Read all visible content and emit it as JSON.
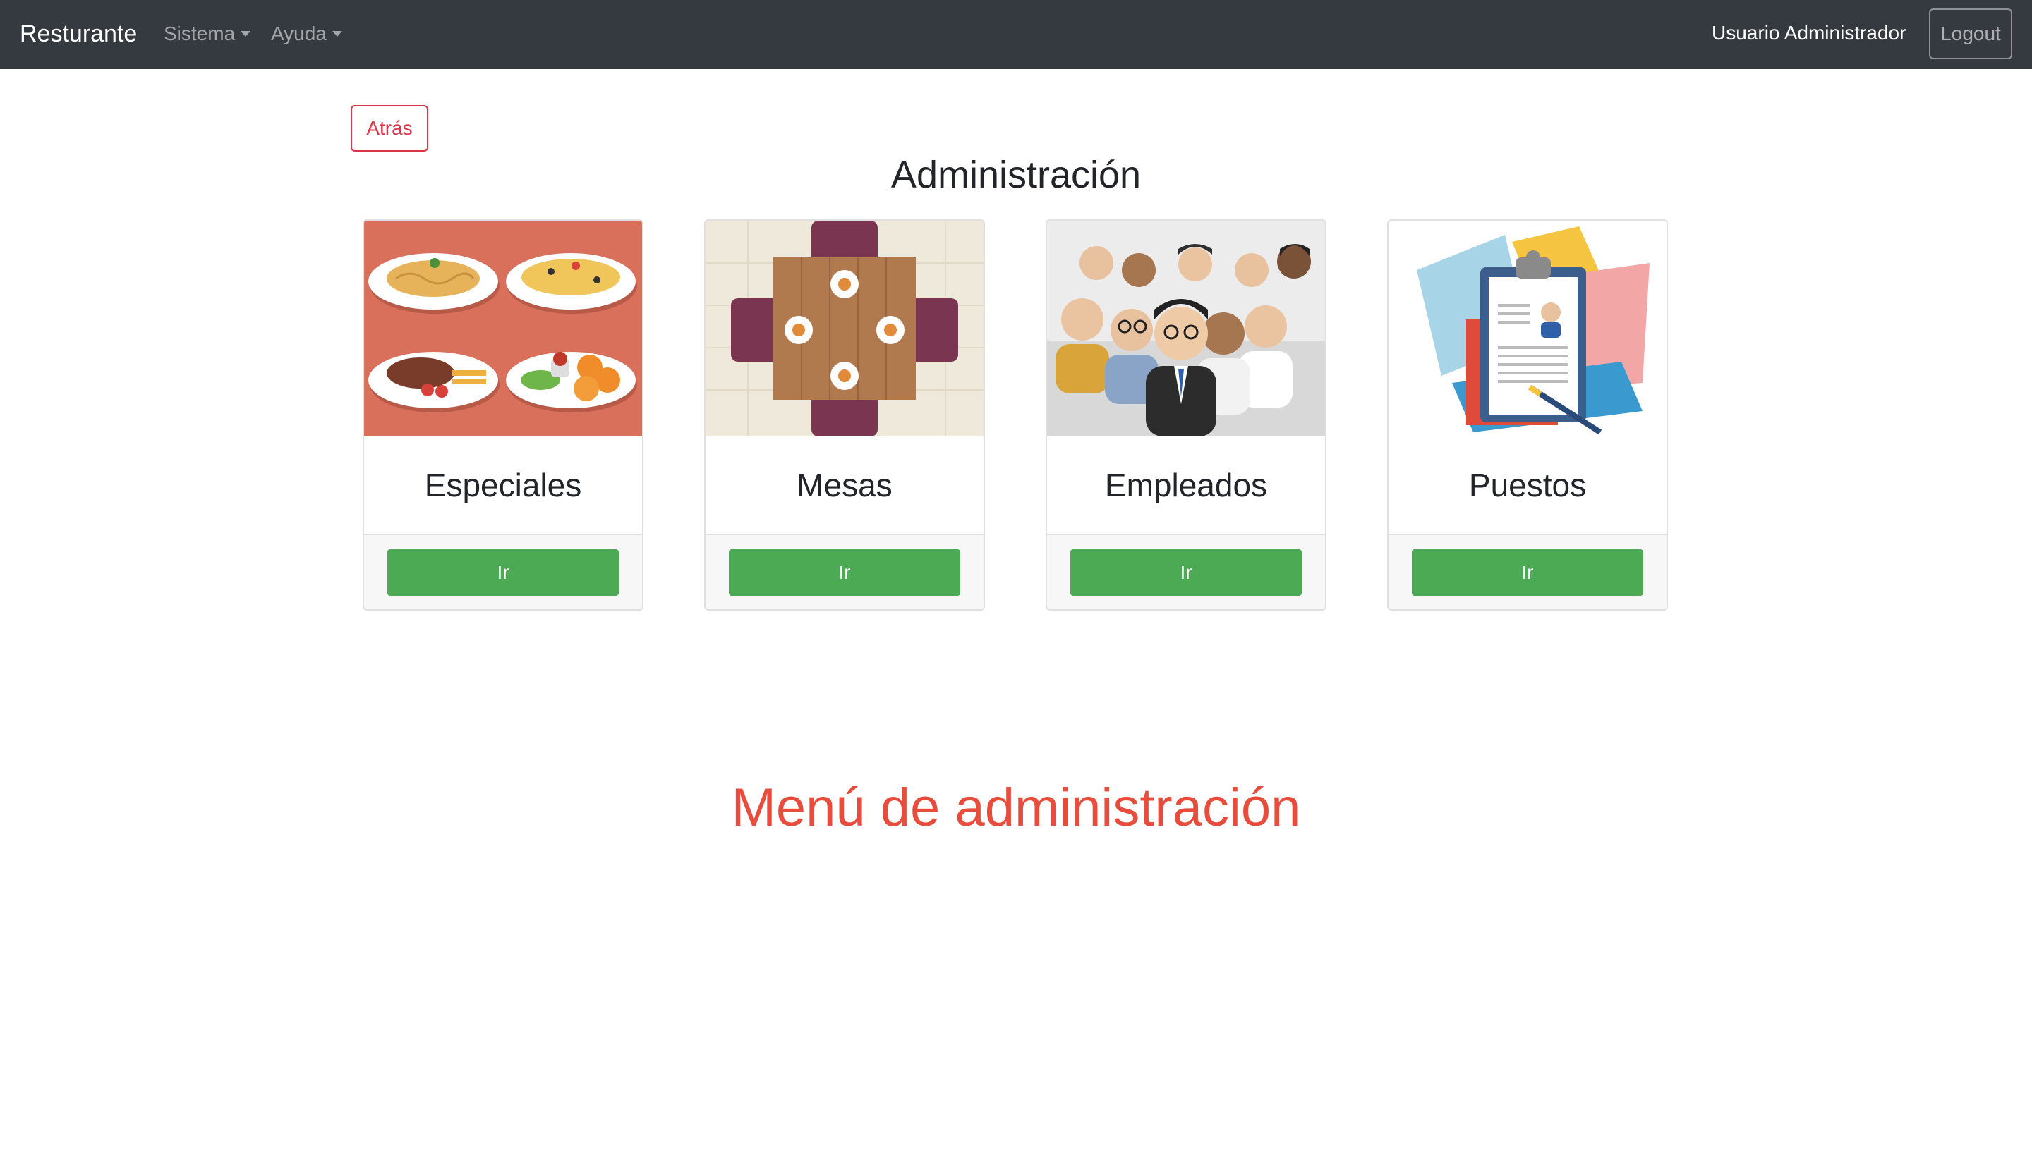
{
  "navbar": {
    "brand": "Resturante",
    "menu_sistema": "Sistema",
    "menu_ayuda": "Ayuda",
    "user": "Usuario Administrador",
    "logout": "Logout"
  },
  "back_button": "Atrás",
  "title": "Administración",
  "cards": [
    {
      "title": "Especiales",
      "button": "Ir",
      "image": "food-plates-illustration"
    },
    {
      "title": "Mesas",
      "button": "Ir",
      "image": "dining-table-illustration"
    },
    {
      "title": "Empleados",
      "button": "Ir",
      "image": "employees-group-illustration"
    },
    {
      "title": "Puestos",
      "button": "Ir",
      "image": "resume-clipboard-illustration"
    }
  ],
  "footer_title": "Menú de administración",
  "colors": {
    "navbar_bg": "#343a40",
    "danger": "#dc3545",
    "success": "#4caa55",
    "footer_title": "#e74c3c"
  }
}
